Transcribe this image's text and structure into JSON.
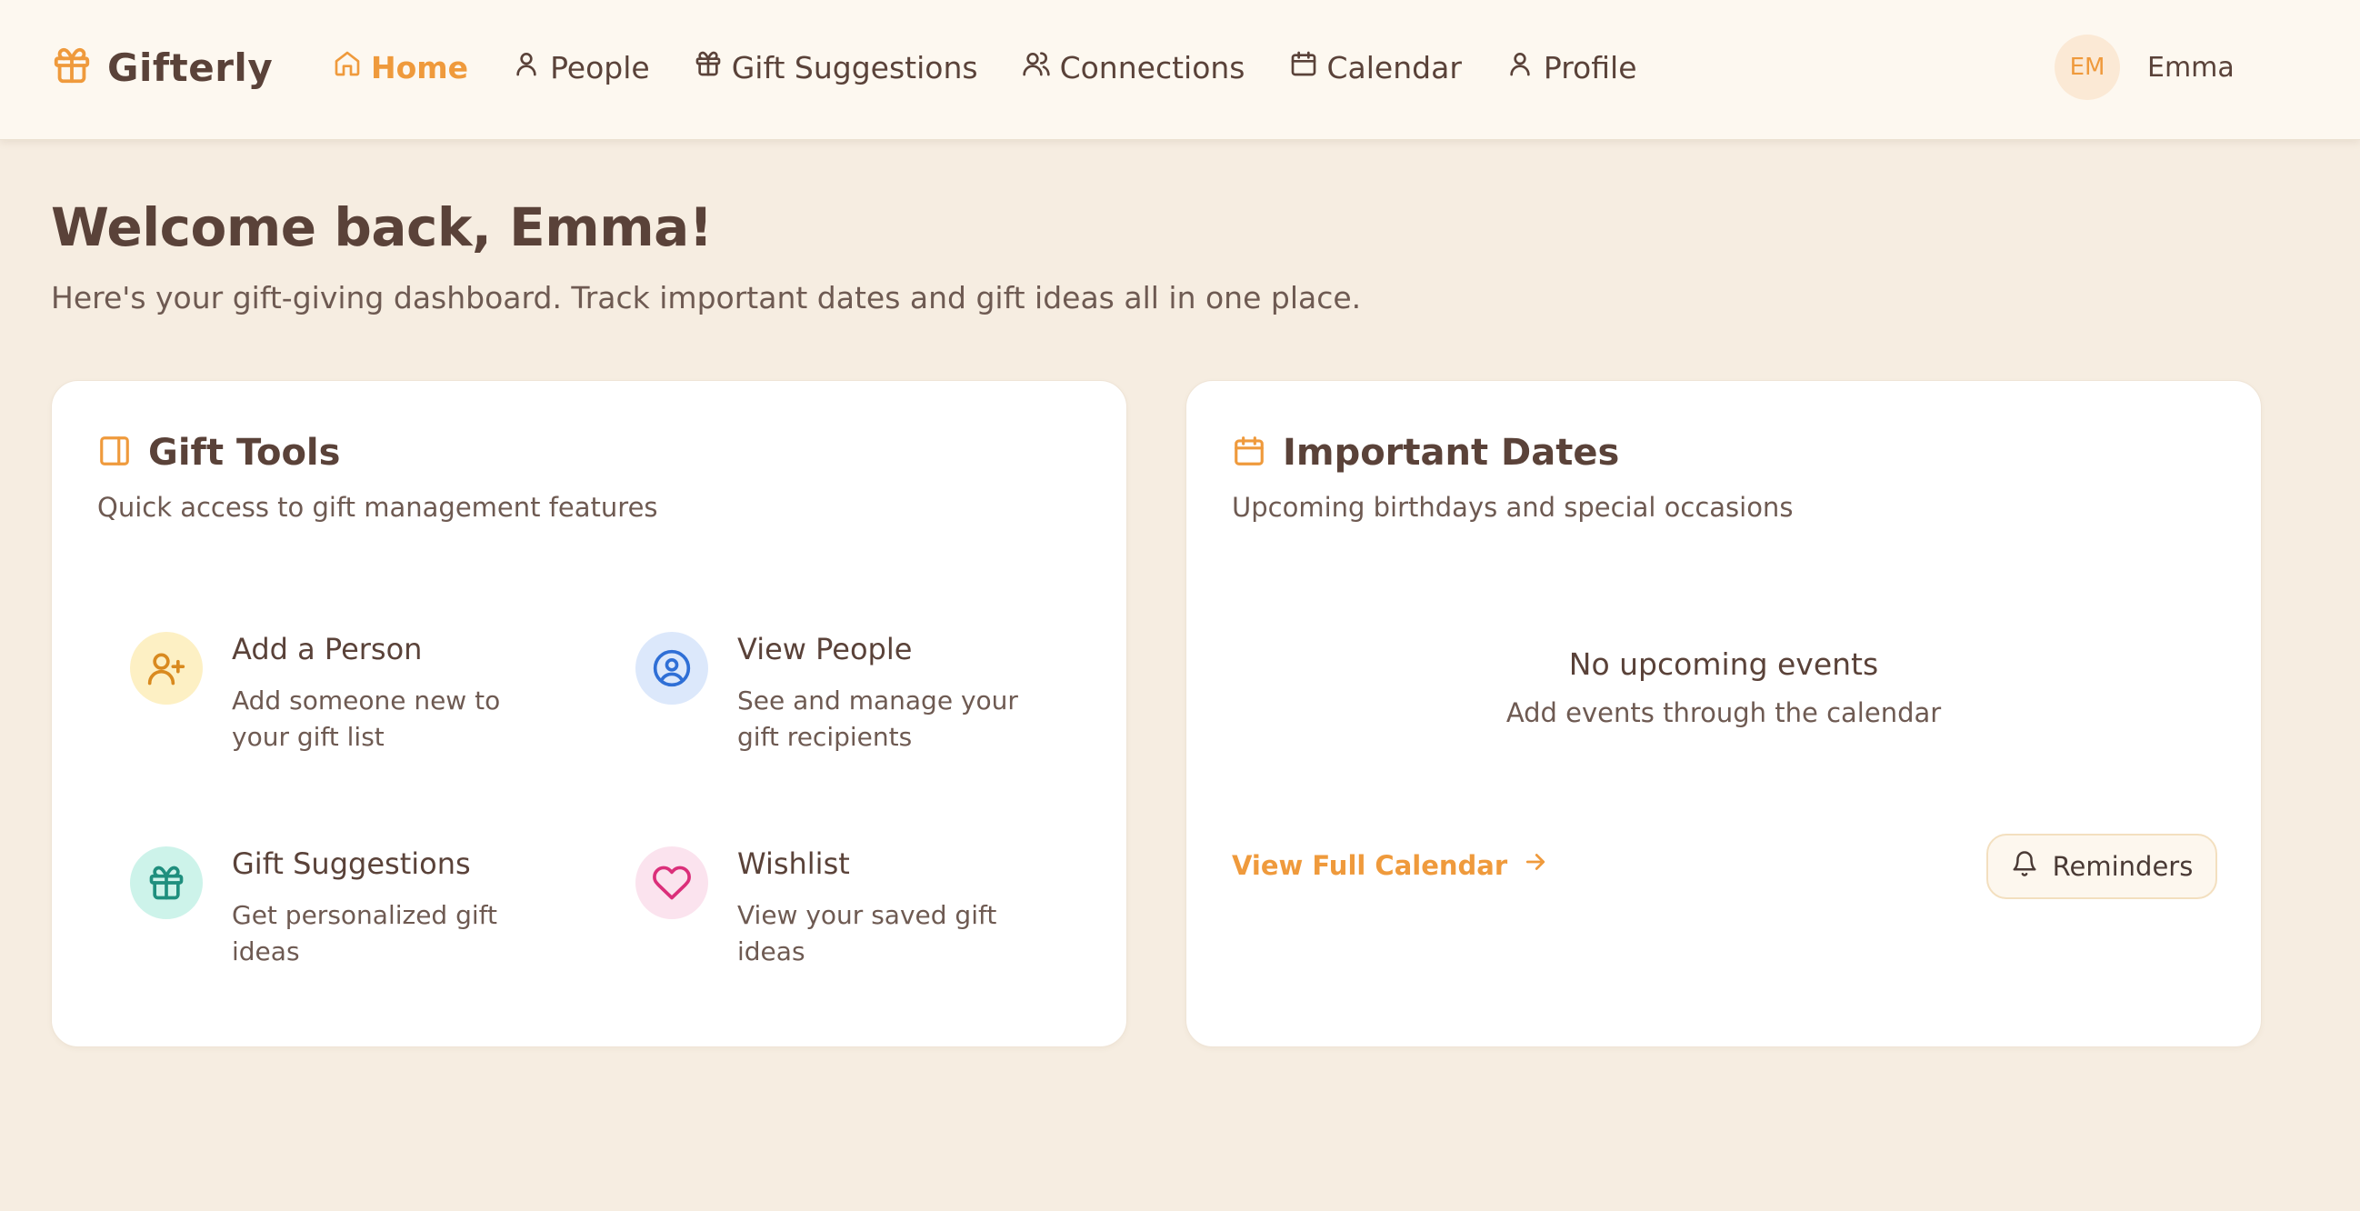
{
  "brand": {
    "name": "Gifterly",
    "icon": "gift-icon"
  },
  "nav": {
    "items": [
      {
        "label": "Home",
        "icon": "home-icon",
        "active": true
      },
      {
        "label": "People",
        "icon": "user-icon"
      },
      {
        "label": "Gift Suggestions",
        "icon": "gift-icon"
      },
      {
        "label": "Connections",
        "icon": "users-icon"
      },
      {
        "label": "Calendar",
        "icon": "calendar-icon"
      },
      {
        "label": "Profile",
        "icon": "user-icon"
      }
    ]
  },
  "user": {
    "initials": "EM",
    "name": "Emma"
  },
  "welcome": {
    "title": "Welcome back, Emma!",
    "subtitle": "Here's your gift-giving dashboard. Track important dates and gift ideas all in one place."
  },
  "gift_tools": {
    "title": "Gift Tools",
    "subtitle": "Quick access to gift management features",
    "icon": "panel-icon",
    "items": [
      {
        "title": "Add a Person",
        "description": "Add someone new to your gift list",
        "icon": "user-plus-icon",
        "bg": "#fdf0c4",
        "color": "#d98a1f"
      },
      {
        "title": "View People",
        "description": "See and manage your gift recipients",
        "icon": "user-circle-icon",
        "bg": "#dce8fb",
        "color": "#2f6fd6"
      },
      {
        "title": "Gift Suggestions",
        "description": "Get personalized gift ideas",
        "icon": "gift-icon",
        "bg": "#cdf3ea",
        "color": "#1f8f7e"
      },
      {
        "title": "Wishlist",
        "description": "View your saved gift ideas",
        "icon": "heart-icon",
        "bg": "#fbe3ee",
        "color": "#db2f7a"
      }
    ]
  },
  "important_dates": {
    "title": "Important Dates",
    "subtitle": "Upcoming birthdays and special occasions",
    "icon": "calendar-icon",
    "empty_title": "No upcoming events",
    "empty_subtitle": "Add events through the calendar",
    "calendar_link": "View Full Calendar",
    "reminders_label": "Reminders"
  },
  "colors": {
    "accent": "#ef9a3c",
    "text": "#5a4239",
    "background": "#f6ede1",
    "header": "#fdf8f0"
  }
}
